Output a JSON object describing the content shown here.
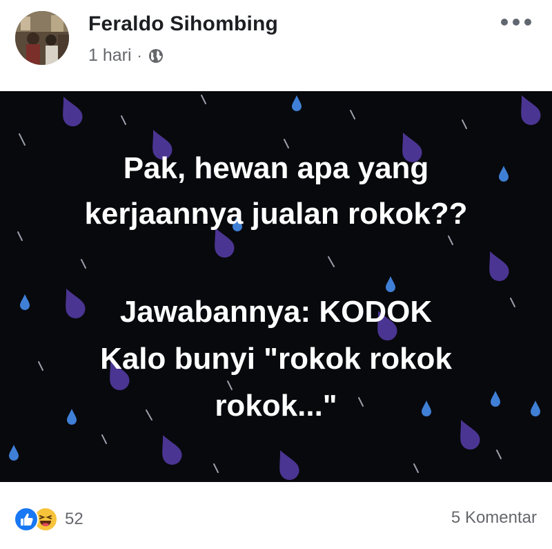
{
  "post": {
    "author": "Feraldo Sihombing",
    "timestamp": "1 hari",
    "separator": "·",
    "privacy_icon": "globe-icon",
    "menu_icon": "more-options-icon"
  },
  "image_text": {
    "line1": "Pak, hewan apa yang",
    "line2": "kerjaannya jualan rokok??",
    "line3": "Jawabannya: KODOK",
    "line4": "Kalo bunyi \"rokok rokok",
    "line5": "rokok...\""
  },
  "footer": {
    "reaction_icons": [
      "like-icon",
      "haha-icon"
    ],
    "reaction_count": "52",
    "comments": "5 Komentar"
  },
  "colors": {
    "image_background": "#08090d",
    "drop_purple": "#5b3fa8",
    "drop_blue": "#4a8fe0",
    "like_blue": "#1877f2",
    "haha_yellow": "#f7c33b"
  }
}
